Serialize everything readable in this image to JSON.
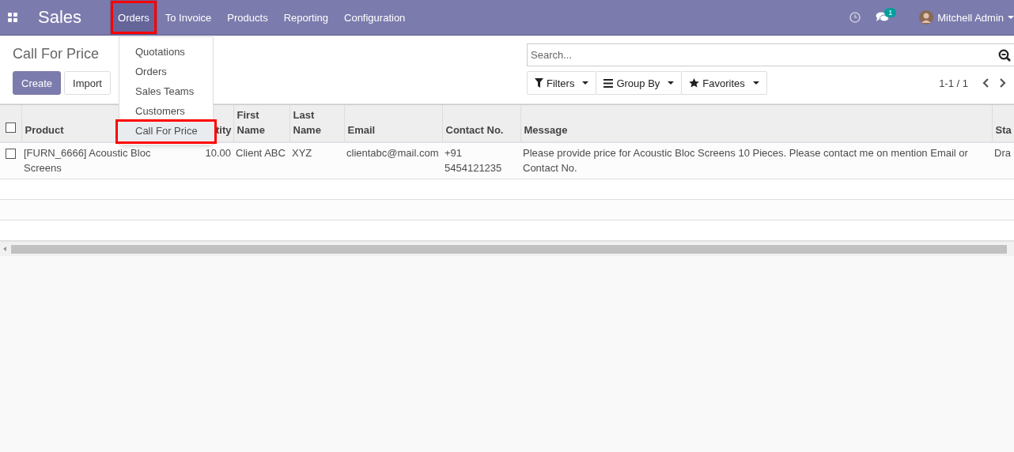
{
  "navbar": {
    "app_name": "Sales",
    "menu": [
      {
        "label": "Orders",
        "selected": true,
        "annotated": true
      },
      {
        "label": "To Invoice",
        "selected": false,
        "annotated": false
      },
      {
        "label": "Products",
        "selected": false,
        "annotated": false
      },
      {
        "label": "Reporting",
        "selected": false,
        "annotated": false
      },
      {
        "label": "Configuration",
        "selected": false,
        "annotated": false
      }
    ],
    "messages_badge": "1",
    "user": "Mitchell Admin"
  },
  "dropdown": {
    "items": [
      {
        "label": "Quotations",
        "selected": false,
        "annotated": false
      },
      {
        "label": "Orders",
        "selected": false,
        "annotated": false
      },
      {
        "label": "Sales Teams",
        "selected": false,
        "annotated": false
      },
      {
        "label": "Customers",
        "selected": false,
        "annotated": false
      },
      {
        "label": "Call For Price",
        "selected": true,
        "annotated": true
      }
    ]
  },
  "page_title": "Call For Price",
  "buttons": [
    {
      "label": "Create",
      "kind": "primary"
    },
    {
      "label": "Import",
      "kind": "secondary"
    }
  ],
  "search": {
    "placeholder": "Search..."
  },
  "filters": [
    {
      "label": "Filters",
      "kind": "filter"
    },
    {
      "label": "Group By",
      "kind": "group"
    },
    {
      "label": "Favorites",
      "kind": "star"
    }
  ],
  "pager": "1-1 / 1",
  "table": {
    "select_all": {
      "checked": false
    },
    "columns": [
      {
        "label": "Product",
        "kind": "text"
      },
      {
        "label": "tity",
        "kind": "number"
      },
      {
        "label": "First Name",
        "kind": "text"
      },
      {
        "label": "Last Name",
        "kind": "text"
      },
      {
        "label": "Email",
        "kind": "text"
      },
      {
        "label": "Contact No.",
        "kind": "text"
      },
      {
        "label": "Message",
        "kind": "text"
      },
      {
        "label": "Sta",
        "kind": "text"
      }
    ],
    "rows": [
      {
        "checked": false,
        "cells": [
          "[FURN_6666] Acoustic Bloc Screens",
          "10.00",
          "Client ABC",
          "XYZ",
          "clientabc@mail.com",
          "+91 5454121235",
          "Please provide price for Acoustic Bloc Screens 10 Pieces. Please contact me on mention Email or Contact No.",
          "Dra"
        ]
      }
    ]
  }
}
